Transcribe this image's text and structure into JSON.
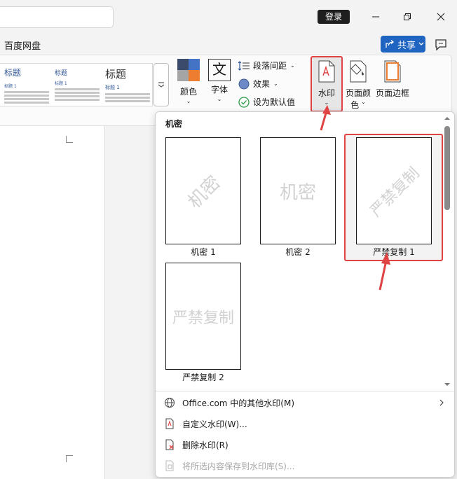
{
  "titlebar": {
    "login_label": "登录",
    "minimize_icon": "minimize-icon",
    "restore_icon": "restore-icon",
    "close_icon": "close-icon"
  },
  "menubar": {
    "tab_label": "百度网盘",
    "share_label": "共享"
  },
  "ribbon": {
    "style_gallery": [
      {
        "title": "标题",
        "subtitle": "标题 1"
      },
      {
        "title": "标题",
        "subtitle": "标题 1"
      },
      {
        "title": "标题",
        "subtitle": "标题 1"
      }
    ],
    "colors_label": "颜色",
    "fonts_label": "字体",
    "fonts_glyph": "文",
    "paragraph_spacing_label": "段落间距",
    "effects_label": "效果",
    "set_default_label": "设为默认值",
    "watermark_label": "水印",
    "page_color_label_line1": "页面颜",
    "page_color_label_line2": "色",
    "page_borders_label": "页面边框",
    "accent_color": "#e04343"
  },
  "watermark_menu": {
    "section_title": "机密",
    "items": [
      {
        "label": "机密 1",
        "text": "机密"
      },
      {
        "label": "机密 2",
        "text": "机密"
      },
      {
        "label": "严禁复制 1",
        "text": "严禁复制"
      },
      {
        "label": "严禁复制 2",
        "text": "严禁复制"
      }
    ],
    "actions": [
      {
        "label": "Office.com 中的其他水印(M)",
        "icon": "globe-icon"
      },
      {
        "label": "自定义水印(W)...",
        "icon": "custom-watermark-icon"
      },
      {
        "label": "删除水印(R)",
        "icon": "remove-watermark-icon"
      },
      {
        "label": "将所选内容保存到水印库(S)...",
        "icon": "save-to-gallery-icon"
      }
    ]
  }
}
